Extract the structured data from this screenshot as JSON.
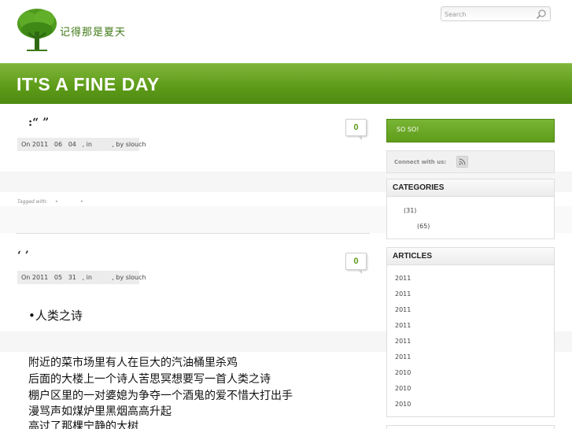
{
  "header": {
    "logo_text": "记得那是夏天",
    "search_placeholder": "Search",
    "banner_title": "IT'S A FINE DAY"
  },
  "posts": [
    {
      "title": ":“                    ”",
      "meta": "On 2011   06   04   , in          , by slouch",
      "comments": "0",
      "tagged": "Tagged with:     •               •"
    },
    {
      "title": "‘          ’",
      "meta": "On 2011   05   31   , in          , by slouch",
      "comments": "0",
      "heading": "•人类之诗",
      "lines": [
        "附近的菜市场里有人在巨大的汽油桶里杀鸡",
        "后面的大楼上一个诗人苦思冥想要写一首人类之诗",
        "棚户区里的一对婆媳为争夺一个酒鬼的爱不惜大打出手",
        "漫骂声如煤炉里黑烟高高升起",
        "高过了那棵宁静的大树"
      ]
    }
  ],
  "sidebar": {
    "soso_label": "SO SO!",
    "connect_label": "Connect with us:",
    "categories_title": "CATEGORIES",
    "categories": [
      "(31)",
      "(65)"
    ],
    "articles_title": "ARTICLES",
    "articles": [
      "2011",
      "2011",
      "2011",
      "2011",
      "2011",
      "2011",
      "2010",
      "2010",
      "2010"
    ]
  }
}
